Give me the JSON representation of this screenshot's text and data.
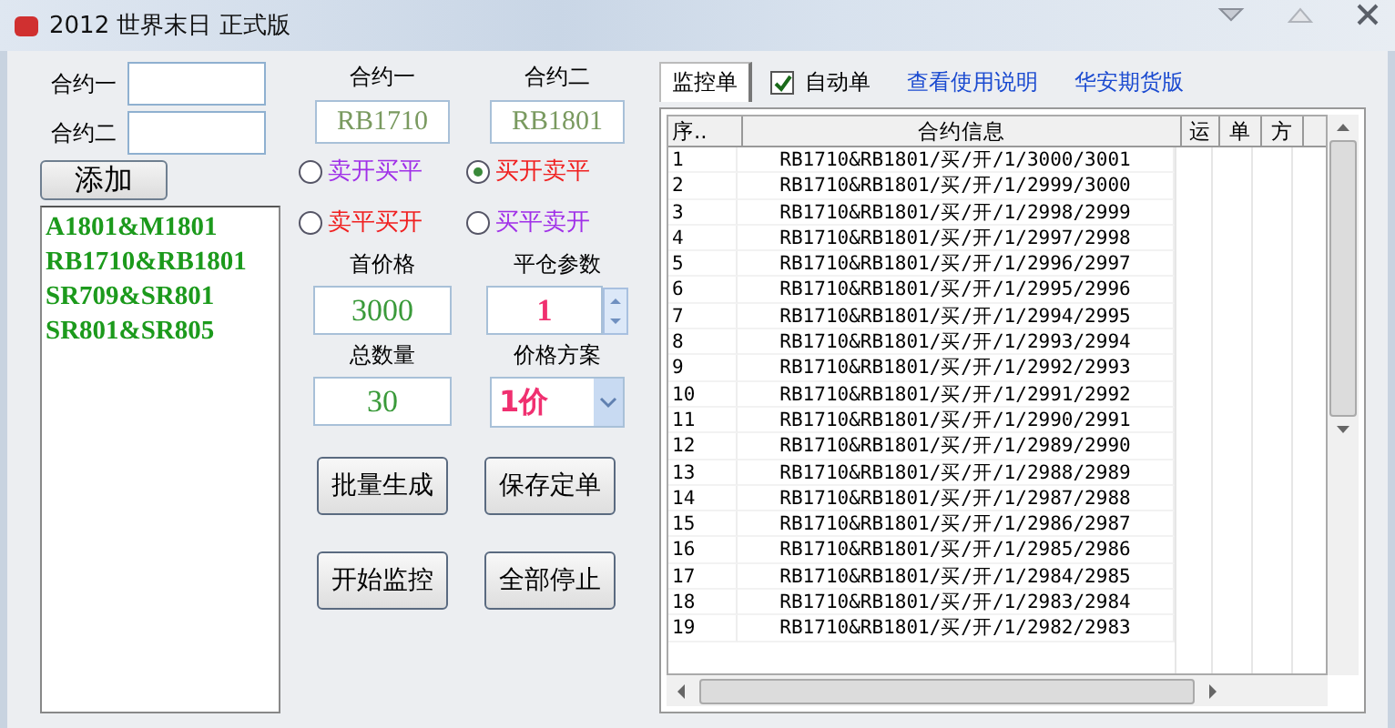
{
  "window": {
    "title": "2012 世界末日 正式版"
  },
  "left": {
    "fields": [
      {
        "label": "合约一"
      },
      {
        "label": "合约二"
      }
    ],
    "add_button": "添加",
    "contracts": [
      "A1801&M1801",
      "RB1710&RB1801",
      "SR709&SR801",
      "SR801&SR805"
    ]
  },
  "middle": {
    "contract_headers": [
      "合约一",
      "合约二"
    ],
    "contract_values": [
      "RB1710",
      "RB1801"
    ],
    "strategies": [
      {
        "label": "卖开买平",
        "selected": false,
        "color": "#a030e8"
      },
      {
        "label": "买开卖平",
        "selected": true,
        "color": "#f02020"
      },
      {
        "label": "卖平买开",
        "selected": false,
        "color": "#f02020"
      },
      {
        "label": "买平卖开",
        "selected": false,
        "color": "#a030e8"
      }
    ],
    "first_price": {
      "label": "首价格",
      "value": "3000"
    },
    "close_param": {
      "label": "平仓参数",
      "value": "1"
    },
    "total": {
      "label": "总数量",
      "value": "30"
    },
    "price_scheme": {
      "label": "价格方案",
      "value": "1价"
    },
    "buttons": [
      "批量生成",
      "保存定单",
      "开始监控",
      "全部停止"
    ]
  },
  "tab_bar": {
    "tabs": [
      {
        "label": "监控单",
        "selected": true
      }
    ],
    "auto_order": {
      "label": "自动单",
      "checked": true
    },
    "links": [
      "查看使用说明",
      "华安期货版"
    ]
  },
  "table": {
    "columns": [
      "序..",
      "合约信息",
      "运",
      "单",
      "方"
    ],
    "rows": [
      {
        "index": "1",
        "info": "RB1710&RB1801/买/开/1/3000/3001"
      },
      {
        "index": "2",
        "info": "RB1710&RB1801/买/开/1/2999/3000"
      },
      {
        "index": "3",
        "info": "RB1710&RB1801/买/开/1/2998/2999"
      },
      {
        "index": "4",
        "info": "RB1710&RB1801/买/开/1/2997/2998"
      },
      {
        "index": "5",
        "info": "RB1710&RB1801/买/开/1/2996/2997"
      },
      {
        "index": "6",
        "info": "RB1710&RB1801/买/开/1/2995/2996"
      },
      {
        "index": "7",
        "info": "RB1710&RB1801/买/开/1/2994/2995"
      },
      {
        "index": "8",
        "info": "RB1710&RB1801/买/开/1/2993/2994"
      },
      {
        "index": "9",
        "info": "RB1710&RB1801/买/开/1/2992/2993"
      },
      {
        "index": "10",
        "info": "RB1710&RB1801/买/开/1/2991/2992"
      },
      {
        "index": "11",
        "info": "RB1710&RB1801/买/开/1/2990/2991"
      },
      {
        "index": "12",
        "info": "RB1710&RB1801/买/开/1/2989/2990"
      },
      {
        "index": "13",
        "info": "RB1710&RB1801/买/开/1/2988/2989"
      },
      {
        "index": "14",
        "info": "RB1710&RB1801/买/开/1/2987/2988"
      },
      {
        "index": "15",
        "info": "RB1710&RB1801/买/开/1/2986/2987"
      },
      {
        "index": "16",
        "info": "RB1710&RB1801/买/开/1/2985/2986"
      },
      {
        "index": "17",
        "info": "RB1710&RB1801/买/开/1/2984/2985"
      },
      {
        "index": "18",
        "info": "RB1710&RB1801/买/开/1/2983/2984"
      },
      {
        "index": "19",
        "info": "RB1710&RB1801/买/开/1/2982/2983"
      }
    ]
  }
}
